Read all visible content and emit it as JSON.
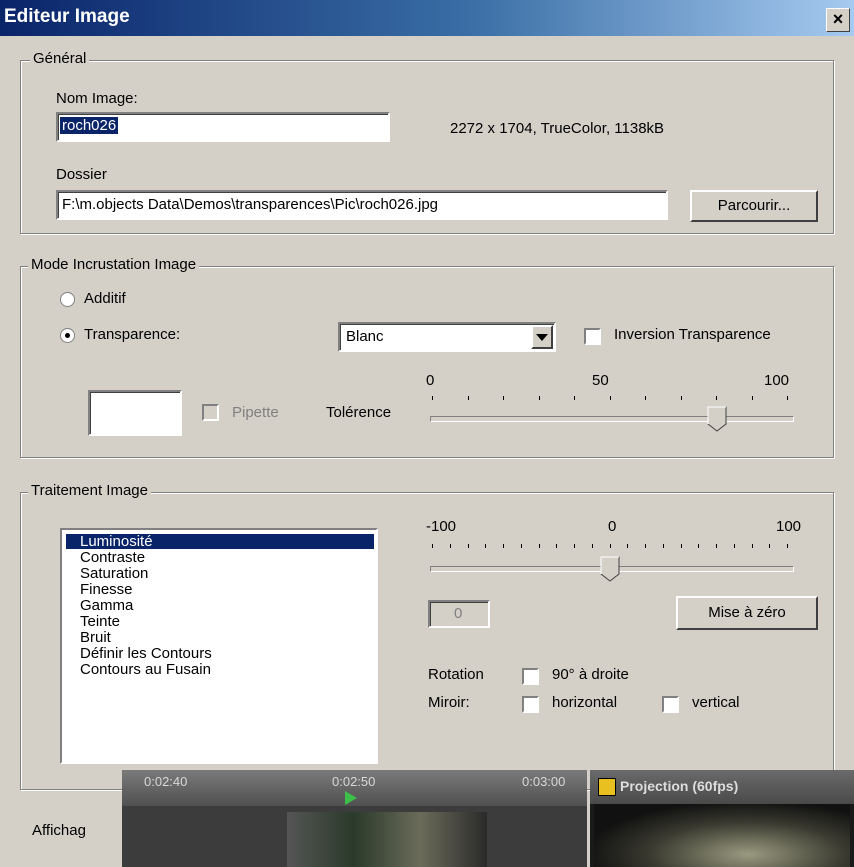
{
  "window": {
    "title": "Editeur Image",
    "close_glyph": "×"
  },
  "general": {
    "legend": "Général",
    "name_label": "Nom Image:",
    "name_value": "roch026",
    "image_info": "2272 x 1704, TrueColor, 1138kB",
    "folder_label": "Dossier",
    "folder_value": "F:\\m.objects Data\\Demos\\transparences\\Pic\\roch026.jpg",
    "browse_button": "Parcourir..."
  },
  "incrustation": {
    "legend": "Mode Incrustation Image",
    "additive_label": "Additif",
    "transparency_label": "Transparence:",
    "selected_mode": "transparence",
    "color_select": "Blanc",
    "invert_label": "Inversion Transparence",
    "invert_checked": false,
    "pipette_label": "Pipette",
    "pipette_enabled": false,
    "tolerance_label": "Tolérence",
    "tolerance_scale": [
      "0",
      "50",
      "100"
    ],
    "tolerance_value": 80
  },
  "processing": {
    "legend": "Traitement Image",
    "items": [
      "Luminosité",
      "Contraste",
      "Saturation",
      "Finesse",
      "Gamma",
      "Teinte",
      "Bruit",
      "Définir les Contours",
      "Contours au Fusain"
    ],
    "selected_index": 0,
    "slider_scale": [
      "-100",
      "0",
      "100"
    ],
    "slider_value": 0,
    "value_field": "0",
    "reset_button": "Mise à zéro",
    "rotation_label": "Rotation",
    "rotation_option": "90° à droite",
    "mirror_label": "Miroir:",
    "mirror_horizontal": "horizontal",
    "mirror_vertical": "vertical"
  },
  "footer": {
    "display_label": "Affichag"
  },
  "overlay": {
    "timeline_labels": [
      "0:02:40",
      "0:02:50",
      "0:03:00"
    ],
    "projection_title": "Projection (60fps)"
  },
  "colors": {
    "dialog": "#d4d0c8",
    "title_start": "#0a246a",
    "title_end": "#a6caf0",
    "selection": "#0a246a"
  }
}
